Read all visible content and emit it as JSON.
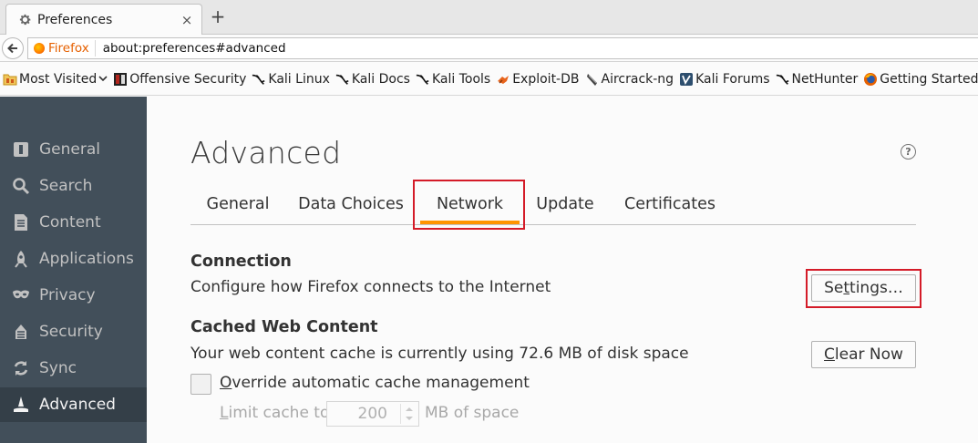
{
  "browser": {
    "tab_title": "Preferences",
    "tab_close": "×",
    "new_tab": "+",
    "identity_label": "Firefox",
    "url": "about:preferences#advanced"
  },
  "bookmarks": [
    {
      "label": "Most Visited",
      "icon": "folder-icon"
    },
    {
      "label": "Offensive Security",
      "icon": "offsec-icon"
    },
    {
      "label": "Kali Linux",
      "icon": "kali-dragon-icon"
    },
    {
      "label": "Kali Docs",
      "icon": "kali-dragon-icon"
    },
    {
      "label": "Kali Tools",
      "icon": "kali-dragon-icon"
    },
    {
      "label": "Exploit-DB",
      "icon": "exploit-db-icon"
    },
    {
      "label": "Aircrack-ng",
      "icon": "aircrack-icon"
    },
    {
      "label": "Kali Forums",
      "icon": "kali-forums-icon"
    },
    {
      "label": "NetHunter",
      "icon": "kali-dragon-icon"
    },
    {
      "label": "Getting Started",
      "icon": "firefox-icon"
    }
  ],
  "sidebar": {
    "items": [
      {
        "label": "General",
        "icon": "general-icon"
      },
      {
        "label": "Search",
        "icon": "search-icon"
      },
      {
        "label": "Content",
        "icon": "content-icon"
      },
      {
        "label": "Applications",
        "icon": "applications-icon"
      },
      {
        "label": "Privacy",
        "icon": "privacy-mask-icon"
      },
      {
        "label": "Security",
        "icon": "security-icon"
      },
      {
        "label": "Sync",
        "icon": "sync-icon"
      },
      {
        "label": "Advanced",
        "icon": "advanced-wizard-icon",
        "selected": true
      }
    ]
  },
  "main": {
    "title": "Advanced",
    "help": "?",
    "tabs": [
      {
        "label": "General"
      },
      {
        "label": "Data Choices"
      },
      {
        "label": "Network",
        "selected": true
      },
      {
        "label": "Update"
      },
      {
        "label": "Certificates"
      }
    ],
    "connection": {
      "title": "Connection",
      "description": "Configure how Firefox connects to the Internet",
      "settings_pre": "Se",
      "settings_key": "t",
      "settings_post": "tings…"
    },
    "cache": {
      "title": "Cached Web Content",
      "description": "Your web content cache is currently using 72.6 MB of disk space",
      "clear_key": "C",
      "clear_post": "lear Now",
      "override_key": "O",
      "override_post": "verride automatic cache management",
      "override_checked": false,
      "limit_key": "L",
      "limit_post": "imit cache to",
      "limit_value": "200",
      "limit_unit": "MB of space"
    }
  },
  "colors": {
    "sidebar_bg": "#424f5a",
    "sidebar_selected_bg": "#343f48",
    "selected_tab_underline": "#ff9500",
    "highlight_box": "#d41b28"
  }
}
